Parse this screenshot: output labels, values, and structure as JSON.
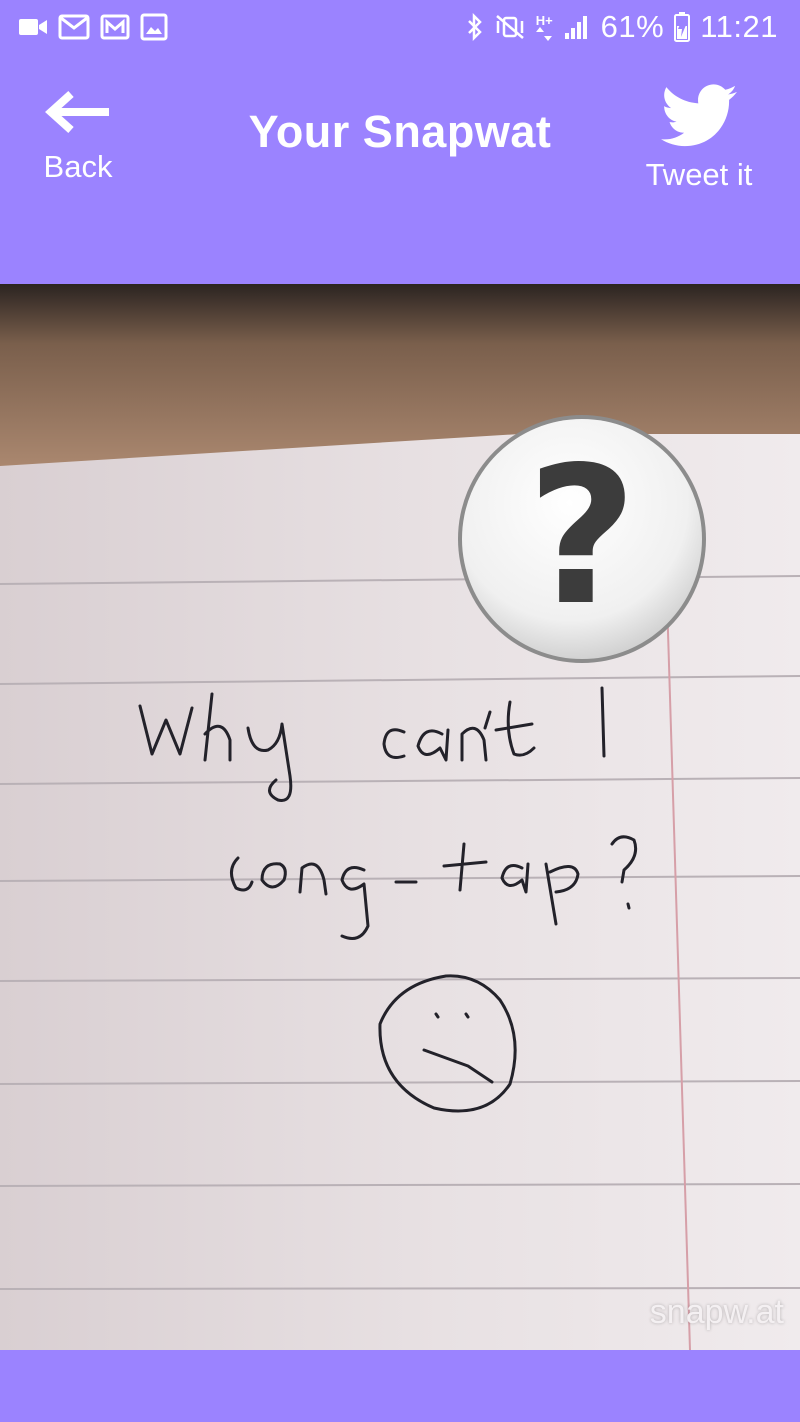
{
  "status_bar": {
    "battery_percent": "61%",
    "time": "11:21",
    "network_type": "H+",
    "left_icons": [
      "video-call-icon",
      "mail-outline-icon",
      "gmail-icon",
      "gallery-icon"
    ],
    "right_icons": [
      "bluetooth-icon",
      "vibrate-mute-icon",
      "data-arrows-icon",
      "signal-icon",
      "battery-charging-icon"
    ]
  },
  "header": {
    "back_label": "Back",
    "title": "Your Snapwat",
    "tweet_label": "Tweet it"
  },
  "photo": {
    "note_text_line1": "Why can't I",
    "note_text_line2": "long-tap?",
    "watermark": "snapw.at"
  },
  "colors": {
    "accent": "#9b83ff",
    "text": "#ffffff"
  }
}
